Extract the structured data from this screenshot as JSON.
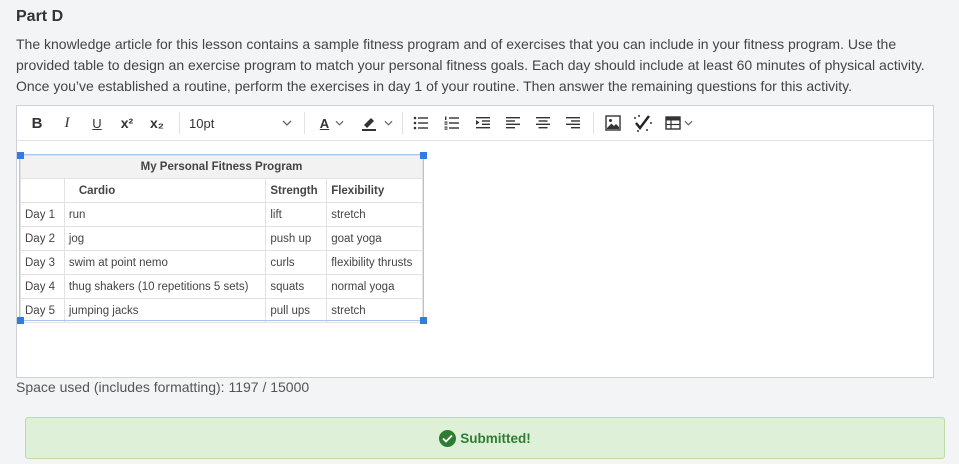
{
  "part": {
    "title": "Part D"
  },
  "instructions": "The knowledge article for this lesson contains a sample fitness program and of exercises that you can include in your fitness program. Use the provided table to design an exercise program to match your personal fitness goals. Each day should include at least 60 minutes of physical activity. Once you’ve established a routine, perform the exercises in day 1 of your routine. Then answer the remaining questions for this activity.",
  "toolbar": {
    "bold": "B",
    "italic": "I",
    "underline": "U",
    "superscript": "x²",
    "subscript": "x₂",
    "font_size": "10pt",
    "font_color_letter": "A",
    "icons": [
      "bold-icon",
      "italic-icon",
      "underline-icon",
      "superscript-icon",
      "subscript-icon",
      "font-color-icon",
      "highlight-icon",
      "bullet-list-icon",
      "numbered-list-icon",
      "indent-icon",
      "align-left-icon",
      "align-center-icon",
      "align-right-icon",
      "image-icon",
      "spellcheck-icon",
      "table-icon"
    ],
    "accent": "#2f7de1"
  },
  "table": {
    "title": "My Personal Fitness Program",
    "headers": [
      "",
      "Cardio",
      "Strength",
      "Flexibility"
    ],
    "rows": [
      [
        "Day 1",
        "run",
        "lift",
        "stretch"
      ],
      [
        "Day 2",
        "jog",
        "push up",
        "goat yoga"
      ],
      [
        "Day 3",
        "swim at point nemo",
        "curls",
        "flexibility thrusts"
      ],
      [
        "Day 4",
        "thug shakers (10 repetitions 5 sets)",
        "squats",
        "normal yoga"
      ],
      [
        "Day 5",
        "jumping jacks",
        "pull ups",
        "stretch"
      ]
    ]
  },
  "space_used": {
    "label": "Space used (includes formatting):",
    "value": "1197 / 15000"
  },
  "status": {
    "text": "Submitted!",
    "color": "#2e7d32",
    "icon": "check-circle-icon"
  }
}
